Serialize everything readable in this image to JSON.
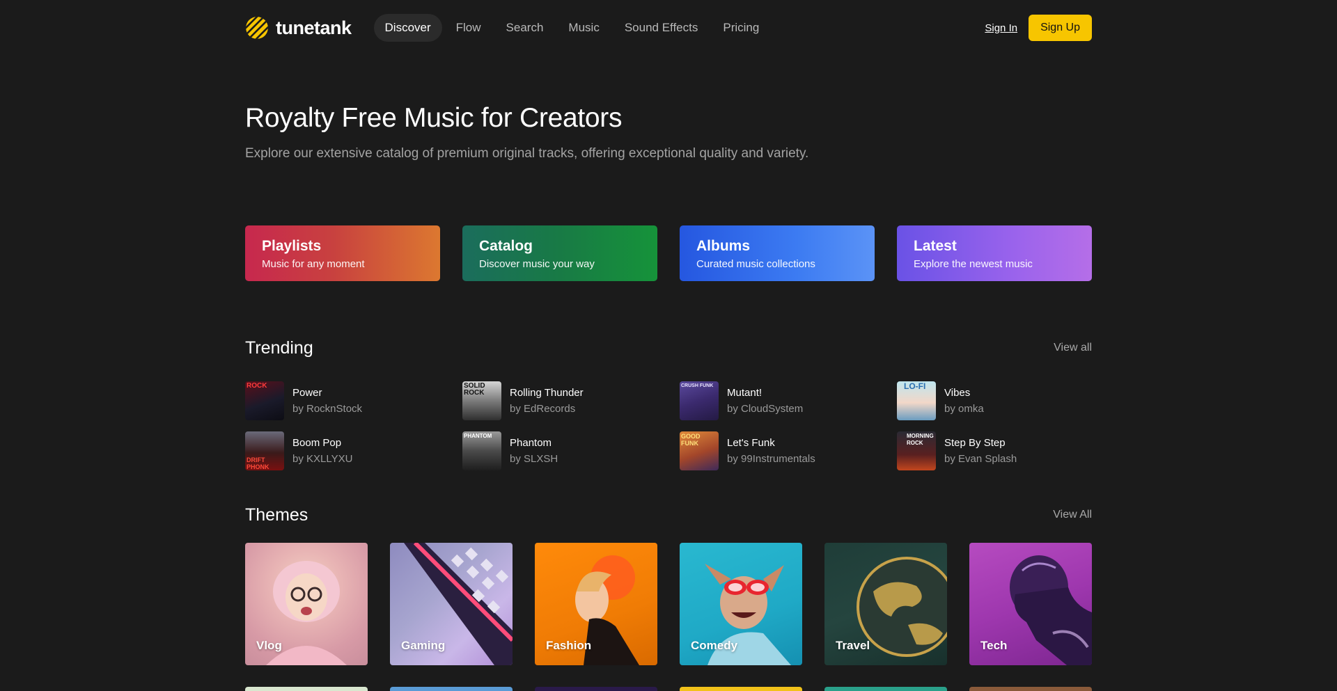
{
  "header": {
    "logo_text": "tunetank",
    "nav": [
      {
        "label": "Discover",
        "active": true
      },
      {
        "label": "Flow"
      },
      {
        "label": "Search"
      },
      {
        "label": "Music"
      },
      {
        "label": "Sound Effects"
      },
      {
        "label": "Pricing"
      }
    ],
    "sign_in": "Sign In",
    "sign_up": "Sign Up"
  },
  "hero": {
    "title": "Royalty Free Music for Creators",
    "subtitle": "Explore our extensive catalog of premium original tracks, offering exceptional quality and variety."
  },
  "categories": [
    {
      "title": "Playlists",
      "subtitle": "Music for any moment"
    },
    {
      "title": "Catalog",
      "subtitle": "Discover music your way"
    },
    {
      "title": "Albums",
      "subtitle": "Curated music collections"
    },
    {
      "title": "Latest",
      "subtitle": "Explore the newest music"
    }
  ],
  "trending": {
    "title": "Trending",
    "view_all": "View all",
    "tracks": [
      {
        "title": "Power",
        "artist": "by RocknStock",
        "cover_text": "ROCK"
      },
      {
        "title": "Rolling Thunder",
        "artist": "by EdRecords",
        "cover_text": "SOLID ROCK"
      },
      {
        "title": "Mutant!",
        "artist": "by CloudSystem",
        "cover_text": "CRUSH FUNK"
      },
      {
        "title": "Vibes",
        "artist": "by omka",
        "cover_text": "LO-FI"
      },
      {
        "title": "Boom Pop",
        "artist": "by KXLLYXU",
        "cover_text": "DRIFT PHONK"
      },
      {
        "title": "Phantom",
        "artist": "by SLXSH",
        "cover_text": "PHANTOM"
      },
      {
        "title": "Let's Funk",
        "artist": "by 99Instrumentals",
        "cover_text": "GOOD FUNK"
      },
      {
        "title": "Step By Step",
        "artist": "by Evan Splash",
        "cover_text": "MORNING ROCK"
      }
    ]
  },
  "themes": {
    "title": "Themes",
    "view_all": "View All",
    "items": [
      {
        "label": "Vlog"
      },
      {
        "label": "Gaming"
      },
      {
        "label": "Fashion"
      },
      {
        "label": "Comedy"
      },
      {
        "label": "Travel"
      },
      {
        "label": "Tech"
      }
    ]
  },
  "colors": {
    "background": "#1b1b1b",
    "accent": "#f7c500"
  }
}
